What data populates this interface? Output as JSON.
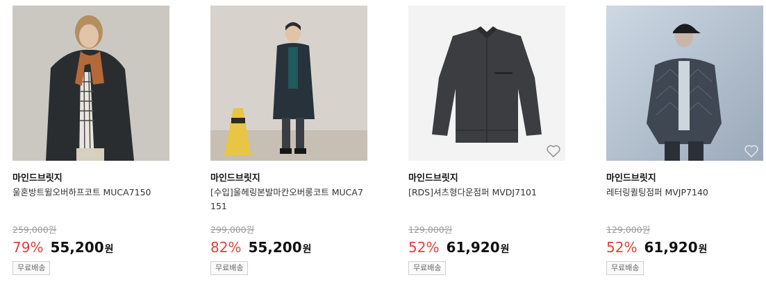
{
  "products": [
    {
      "brand": "마인드브릿지",
      "title": "울혼방트윌오버하프코트 MUCA7150",
      "original_price": "259,000원",
      "discount_rate": "79%",
      "sale_price": "55,200",
      "currency": "원",
      "shipping_badge": "무료배송",
      "image_icon": "product-photo",
      "show_wishlist": false
    },
    {
      "brand": "마인드브릿지",
      "title": "[수입]울헤링본발마칸오버롱코트 MUCA7151",
      "original_price": "299,000원",
      "discount_rate": "82%",
      "sale_price": "55,200",
      "currency": "원",
      "shipping_badge": "무료배송",
      "image_icon": "product-photo",
      "show_wishlist": false
    },
    {
      "brand": "마인드브릿지",
      "title": "[RDS]셔츠형다운점퍼 MVDJ7101",
      "original_price": "129,000원",
      "discount_rate": "52%",
      "sale_price": "61,920",
      "currency": "원",
      "shipping_badge": "무료배송",
      "image_icon": "product-photo",
      "show_wishlist": true
    },
    {
      "brand": "마인드브릿지",
      "title": "레터링퀼팅점퍼 MVJP7140",
      "original_price": "129,000원",
      "discount_rate": "52%",
      "sale_price": "61,920",
      "currency": "원",
      "shipping_badge": "무료배송",
      "image_icon": "product-photo",
      "show_wishlist": true
    }
  ],
  "colors": {
    "discount": "#e0413a",
    "price": "#111111",
    "original_price": "#9a9a9a",
    "badge_border": "#cfcfcf"
  },
  "icons": {
    "wishlist": "heart-outline-icon"
  }
}
